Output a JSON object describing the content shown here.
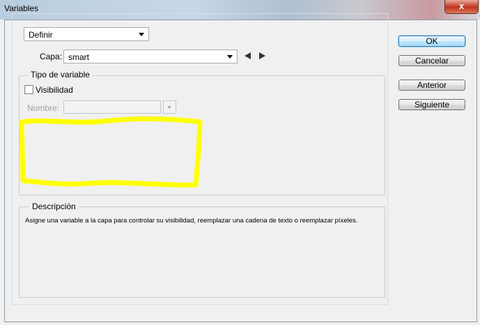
{
  "window": {
    "title": "Variables",
    "close_glyph": "x"
  },
  "top": {
    "mode_select": "Definir",
    "layer_label": "Capa:",
    "layer_select": "smart"
  },
  "variable_type": {
    "legend": "Tipo de variable",
    "visibility_label": "Visibilidad",
    "visibility_checked": false,
    "name_label": "Nombre:",
    "name_value": ""
  },
  "description": {
    "legend": "Descripción",
    "text": "Asigne una variable a la capa para controlar su visibilidad, reemplazar una cadena de texto o reemplazar píxeles."
  },
  "buttons": {
    "ok": "OK",
    "cancel": "Cancelar",
    "previous": "Anterior",
    "next": "Siguiente"
  },
  "colors": {
    "highlight_marker": "#ffff00",
    "default_button_border": "#3c7fb1"
  }
}
